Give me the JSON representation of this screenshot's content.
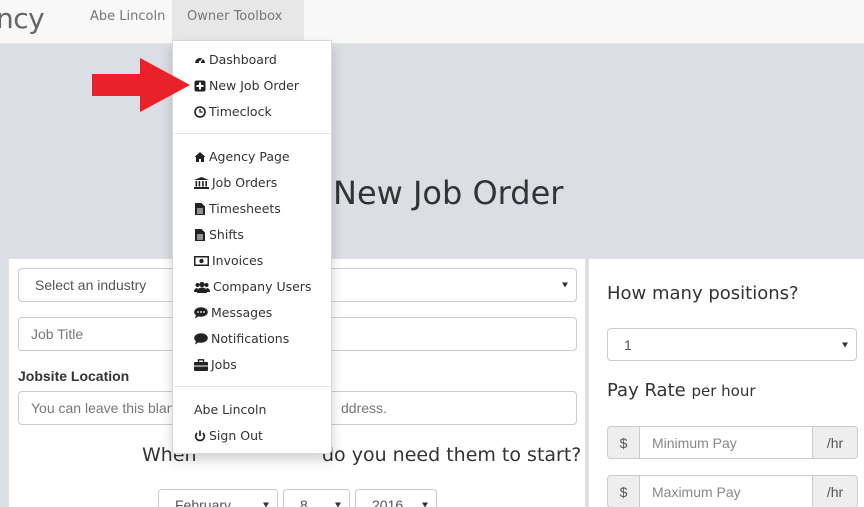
{
  "navbar": {
    "brand": "ncy",
    "user_link": "Abe Lincoln",
    "toolbox_link": "Owner Toolbox"
  },
  "dropdown": {
    "group1": [
      {
        "label": "Dashboard",
        "icon": "dashboard-icon"
      },
      {
        "label": "New Job Order",
        "icon": "plus-square-icon"
      },
      {
        "label": "Timeclock",
        "icon": "clock-icon"
      }
    ],
    "group2": [
      {
        "label": "Agency Page",
        "icon": "home-icon"
      },
      {
        "label": "Job Orders",
        "icon": "bank-icon"
      },
      {
        "label": "Timesheets",
        "icon": "file-icon"
      },
      {
        "label": "Shifts",
        "icon": "file-icon"
      },
      {
        "label": "Invoices",
        "icon": "money-icon"
      },
      {
        "label": "Company Users",
        "icon": "users-icon"
      },
      {
        "label": "Messages",
        "icon": "comment-dots-icon"
      },
      {
        "label": "Notifications",
        "icon": "comment-icon"
      },
      {
        "label": "Jobs",
        "icon": "briefcase-icon"
      }
    ],
    "group3": [
      {
        "label": "Abe Lincoln",
        "icon": ""
      },
      {
        "label": "Sign Out",
        "icon": "power-icon"
      }
    ]
  },
  "page": {
    "title": "New Job Order"
  },
  "form": {
    "industry_select": "Select an industry",
    "job_title_placeholder": "Job Title",
    "jobsite_label": "Jobsite Location",
    "jobsite_placeholder_left": "You can leave this blan",
    "jobsite_placeholder_right": "ddress.",
    "start_question_left": "When",
    "start_question_right": "do you need them to start?",
    "month": "February",
    "day": "8",
    "year": "2016"
  },
  "right_panel": {
    "positions_question": "How many positions?",
    "positions_value": "1",
    "pay_rate_label": "Pay Rate",
    "pay_rate_unit": "per hour",
    "min_pay_placeholder": "Minimum Pay",
    "max_pay_placeholder": "Maximum Pay",
    "currency": "$",
    "per_hr": "/hr"
  },
  "colors": {
    "arrow": "#e8212b",
    "hero_bg": "#dcdee5",
    "navbar_bg": "#f8f8f8"
  }
}
